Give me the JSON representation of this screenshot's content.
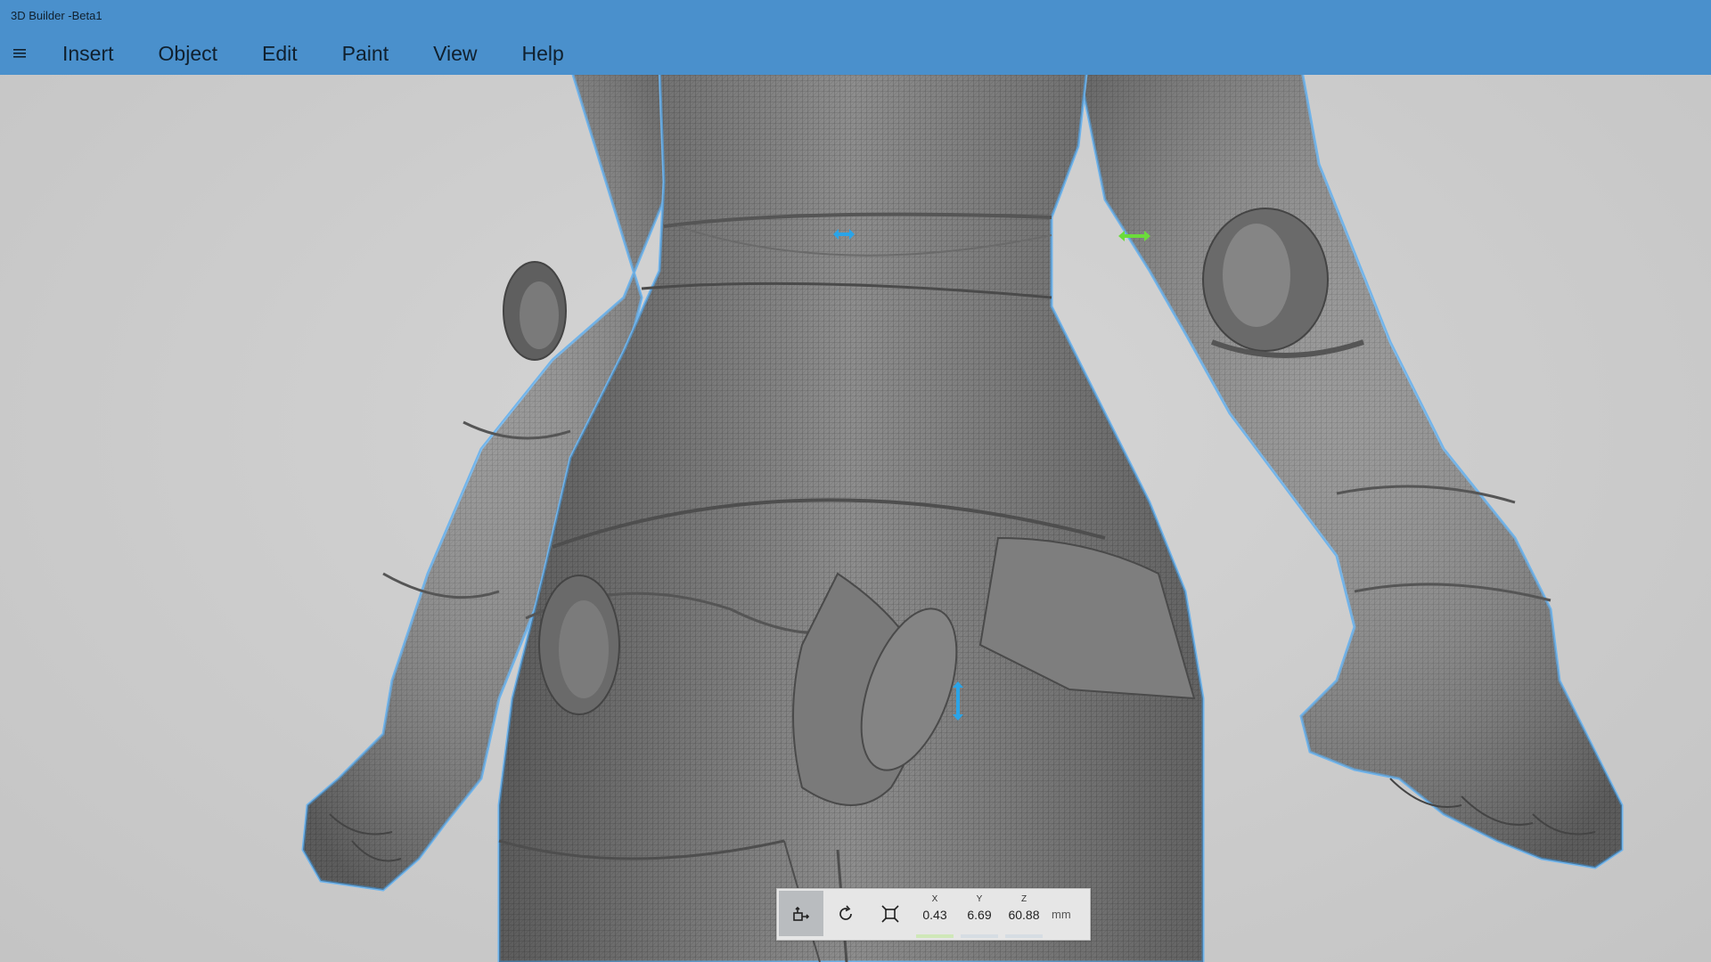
{
  "window": {
    "title": "3D Builder -Beta1"
  },
  "menu": {
    "items": [
      {
        "id": "insert",
        "label": "Insert"
      },
      {
        "id": "object",
        "label": "Object"
      },
      {
        "id": "edit",
        "label": "Edit"
      },
      {
        "id": "paint",
        "label": "Paint"
      },
      {
        "id": "view",
        "label": "View"
      },
      {
        "id": "help",
        "label": "Help"
      }
    ]
  },
  "toolbar": {
    "tools": [
      {
        "id": "move",
        "icon": "move-icon",
        "active": true
      },
      {
        "id": "rotate",
        "icon": "rotate-icon",
        "active": false
      },
      {
        "id": "scale",
        "icon": "scale-icon",
        "active": false
      }
    ],
    "coords": {
      "x": {
        "label": "X",
        "value": "0.43"
      },
      "y": {
        "label": "Y",
        "value": "6.69"
      },
      "z": {
        "label": "Z",
        "value": "60.88"
      }
    },
    "unit": "mm"
  },
  "colors": {
    "chrome": "#4a90cc",
    "selection_outline": "#6fb4ec",
    "handle_blue": "#2aa4e8",
    "handle_green": "#6bdc3a",
    "model": "#8a8a8a"
  }
}
